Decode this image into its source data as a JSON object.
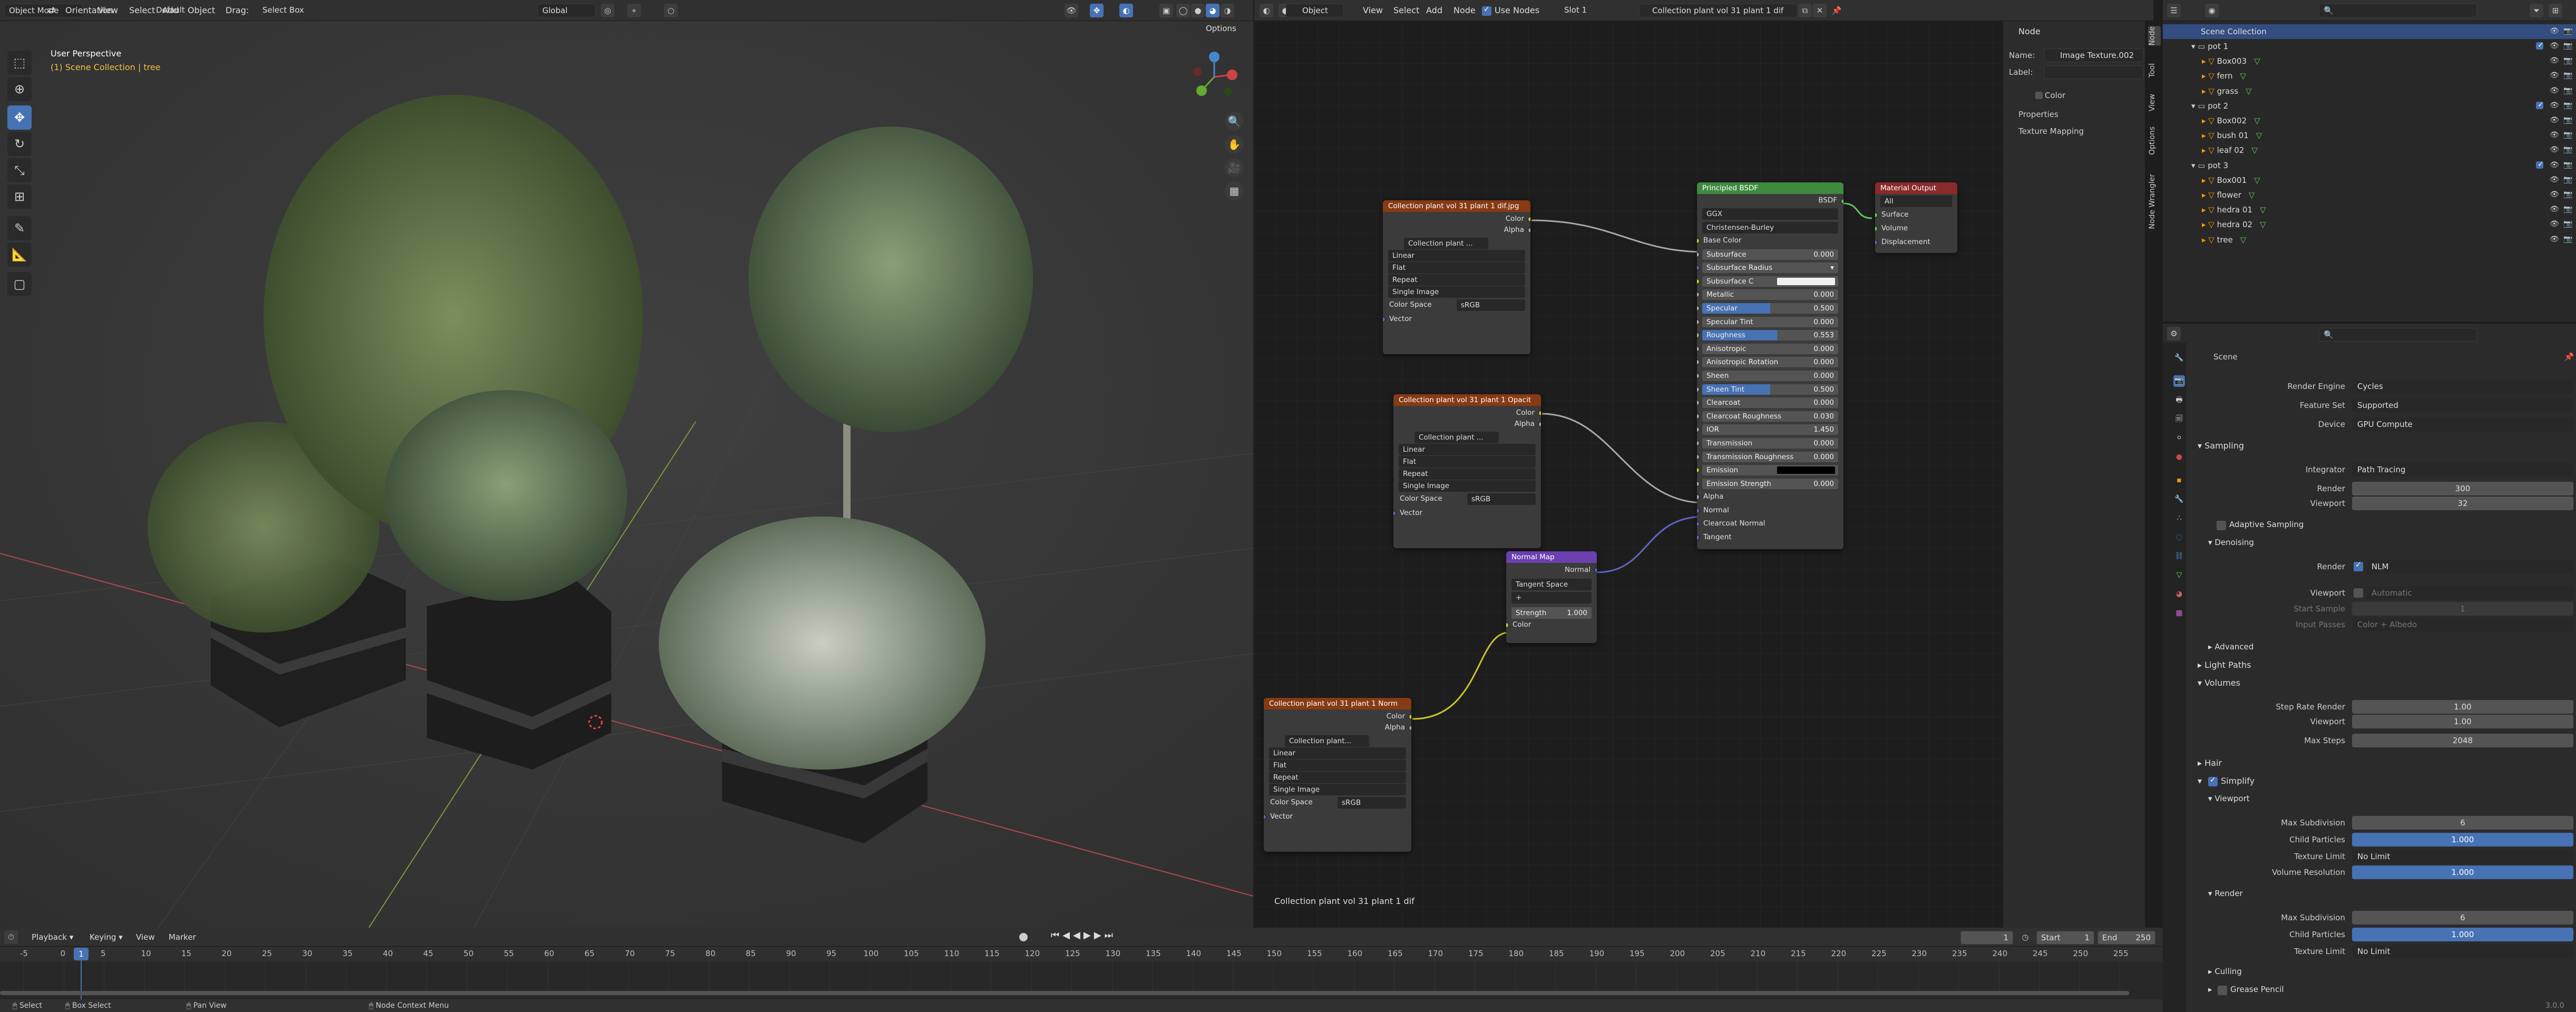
{
  "viewport": {
    "mode": "Object Mode",
    "menus": [
      "View",
      "Select",
      "Add",
      "Object"
    ],
    "orientation_label": "Orientation",
    "orientation_value": "Default",
    "drag_label": "Drag:",
    "drag_value": "Select Box",
    "transform": "Global",
    "options": "Options",
    "title": "User Perspective",
    "subtitle": "(1) Scene Collection | tree"
  },
  "node_editor": {
    "editor": "Object",
    "menus": [
      "View",
      "Select",
      "Add",
      "Node"
    ],
    "use_nodes": "Use Nodes",
    "slot": "Slot 1",
    "material": "Collection plant vol 31 plant 1 dif",
    "footer": "Collection plant vol 31 plant 1 dif",
    "tex_nodes": [
      {
        "title": "Collection plant vol 31 plant 1 dif.jpg",
        "image": "Collection plant ...",
        "interp": "Linear",
        "proj": "Flat",
        "ext": "Repeat",
        "src": "Single Image",
        "cs_label": "Color Space",
        "cs": "sRGB",
        "out1": "Color",
        "out2": "Alpha",
        "in": "Vector"
      },
      {
        "title": "Collection plant vol 31 plant 1 Opacit",
        "image": "Collection plant ...",
        "interp": "Linear",
        "proj": "Flat",
        "ext": "Repeat",
        "src": "Single Image",
        "cs_label": "Color Space",
        "cs": "sRGB",
        "out1": "Color",
        "out2": "Alpha",
        "in": "Vector"
      },
      {
        "title": "Collection plant vol 31 plant 1 Norm",
        "image": "Collection plant...",
        "interp": "Linear",
        "proj": "Flat",
        "ext": "Repeat",
        "src": "Single Image",
        "cs_label": "Color Space",
        "cs": "sRGB",
        "out1": "Color",
        "out2": "Alpha",
        "in": "Vector"
      }
    ],
    "normal_map": {
      "title": "Normal Map",
      "out": "Normal",
      "space": "Tangent Space",
      "uv": "+",
      "strength_label": "Strength",
      "strength": "1.000",
      "in": "Color"
    },
    "bsdf": {
      "title": "Principled BSDF",
      "out": "BSDF",
      "dist": "GGX",
      "sss": "Christensen-Burley",
      "rows": [
        {
          "l": "Base Color",
          "t": "s"
        },
        {
          "l": "Subsurface",
          "v": "0.000"
        },
        {
          "l": "Subsurface Radius",
          "t": "d"
        },
        {
          "l": "Subsurface C",
          "t": "w"
        },
        {
          "l": "Metallic",
          "v": "0.000"
        },
        {
          "l": "Specular",
          "v": "0.500",
          "t": "b"
        },
        {
          "l": "Specular Tint",
          "v": "0.000"
        },
        {
          "l": "Roughness",
          "v": "0.553",
          "t": "b"
        },
        {
          "l": "Anisotropic",
          "v": "0.000"
        },
        {
          "l": "Anisotropic Rotation",
          "v": "0.000"
        },
        {
          "l": "Sheen",
          "v": "0.000"
        },
        {
          "l": "Sheen Tint",
          "v": "0.500",
          "t": "b"
        },
        {
          "l": "Clearcoat",
          "v": "0.000"
        },
        {
          "l": "Clearcoat Roughness",
          "v": "0.030"
        },
        {
          "l": "IOR",
          "v": "1.450"
        },
        {
          "l": "Transmission",
          "v": "0.000"
        },
        {
          "l": "Transmission Roughness",
          "v": "0.000"
        },
        {
          "l": "Emission",
          "t": "k"
        },
        {
          "l": "Emission Strength",
          "v": "0.000"
        },
        {
          "l": "Alpha",
          "t": "s"
        },
        {
          "l": "Normal",
          "t": "s"
        },
        {
          "l": "Clearcoat Normal",
          "t": "s"
        },
        {
          "l": "Tangent",
          "t": "s"
        }
      ]
    },
    "output": {
      "title": "Material Output",
      "target": "All",
      "inputs": [
        "Surface",
        "Volume",
        "Displacement"
      ]
    }
  },
  "sidebar": {
    "header": "Node",
    "name_label": "Name:",
    "name": "Image Texture.002",
    "label_label": "Label:",
    "color": "Color",
    "properties": "Properties",
    "texture_mapping": "Texture Mapping",
    "tabs": [
      "Node",
      "Tool",
      "View",
      "Options",
      "Node Wrangler"
    ]
  },
  "outliner": {
    "root": "Scene Collection",
    "items": [
      {
        "n": "pot 1",
        "lvl": 0,
        "c": true
      },
      {
        "n": "Box003",
        "lvl": 1
      },
      {
        "n": "fern",
        "lvl": 1
      },
      {
        "n": "grass",
        "lvl": 1
      },
      {
        "n": "pot 2",
        "lvl": 0,
        "c": true
      },
      {
        "n": "Box002",
        "lvl": 1
      },
      {
        "n": "bush 01",
        "lvl": 1
      },
      {
        "n": "leaf 02",
        "lvl": 1
      },
      {
        "n": "pot 3",
        "lvl": 0,
        "c": true
      },
      {
        "n": "Box001",
        "lvl": 1
      },
      {
        "n": "flower",
        "lvl": 1
      },
      {
        "n": "hedra 01",
        "lvl": 1
      },
      {
        "n": "hedra 02",
        "lvl": 1
      },
      {
        "n": "tree",
        "lvl": 1
      }
    ]
  },
  "properties": {
    "scene": "Scene",
    "render_engine_label": "Render Engine",
    "render_engine": "Cycles",
    "feature_set_label": "Feature Set",
    "feature_set": "Supported",
    "device_label": "Device",
    "device": "GPU Compute",
    "sampling": "Sampling",
    "integrator_label": "Integrator",
    "integrator": "Path Tracing",
    "render_label": "Render",
    "render_samples": "300",
    "viewport_label": "Viewport",
    "viewport_samples": "32",
    "adaptive": "Adaptive Sampling",
    "denoising": "Denoising",
    "den_render": "NLM",
    "den_viewport": "Automatic",
    "start_sample_label": "Start Sample",
    "start_sample": "1",
    "input_passes_label": "Input Passes",
    "input_passes": "Color + Albedo",
    "advanced": "Advanced",
    "light_paths": "Light Paths",
    "volumes": "Volumes",
    "step_render_label": "Step Rate Render",
    "step_render": "1.00",
    "step_viewport_label": "Viewport",
    "step_viewport": "1.00",
    "max_steps_label": "Max Steps",
    "max_steps": "2048",
    "hair": "Hair",
    "simplify": "Simplify",
    "s_viewport": "Viewport",
    "max_sub_label": "Max Subdivision",
    "max_sub": "6",
    "child_label": "Child Particles",
    "child": "1.000",
    "tex_limit_label": "Texture Limit",
    "tex_limit": "No Limit",
    "vol_res_label": "Volume Resolution",
    "vol_res": "1.000",
    "s_render": "Render",
    "r_max_sub": "6",
    "r_child": "1.000",
    "r_tex_limit": "No Limit",
    "culling": "Culling",
    "grease": "Grease Pencil"
  },
  "timeline": {
    "menus": [
      "Playback",
      "Keying",
      "View",
      "Marker"
    ],
    "current": "1",
    "start_label": "Start",
    "start": "1",
    "end_label": "End",
    "end": "250",
    "ticks": [
      "-5",
      "0",
      "5",
      "10",
      "15",
      "20",
      "25",
      "30",
      "35",
      "40",
      "45",
      "50",
      "55",
      "60",
      "65",
      "70",
      "75",
      "80",
      "85",
      "90",
      "95",
      "100",
      "105",
      "110",
      "115",
      "120",
      "125",
      "130",
      "135",
      "140",
      "145",
      "150",
      "155",
      "160",
      "165",
      "170",
      "175",
      "180",
      "185",
      "190",
      "195",
      "200",
      "205",
      "210",
      "215",
      "220",
      "225",
      "230",
      "235",
      "240",
      "245",
      "250",
      "255"
    ]
  },
  "status": {
    "select": "Select",
    "box": "Box Select",
    "pan": "Pan View",
    "ctx": "Node Context Menu",
    "version": "3.0.0"
  }
}
